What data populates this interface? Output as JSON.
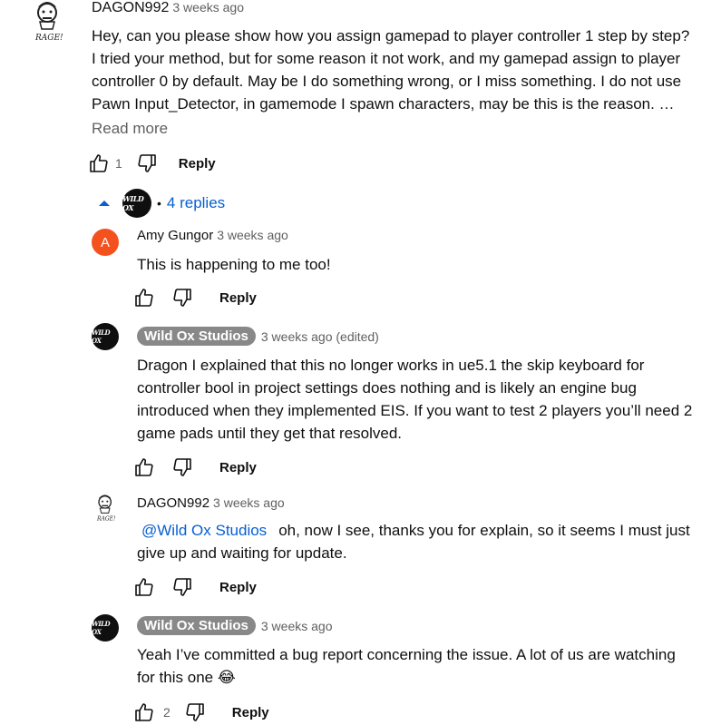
{
  "comment": {
    "author": "DAGON992",
    "time": "3 weeks ago",
    "lines": [
      "Hey, can you please show how you assign gamepad to player controller 1 step by step?",
      "I tried your method, but for some reason it not work, and my gamepad assign to player",
      "controller 0 by default. May be I do something wrong, or I miss something. I do not use",
      "Pawn Input_Detector, in gamemode I spawn characters, may be this is the reason. …"
    ],
    "read_more": "Read more",
    "likes": "1",
    "reply_label": "Reply",
    "avatar_caption": "RAGE!"
  },
  "replies_toggle": {
    "label": "4 replies",
    "separator": "•",
    "avatar_text": "WILD OX"
  },
  "replies": [
    {
      "author": "Amy Gungor",
      "time": "3 weeks ago",
      "avatar_letter": "A",
      "avatar_color": "#f4511e",
      "lines": [
        "This is happening to me too!"
      ],
      "reply_label": "Reply"
    },
    {
      "author": "Wild Ox Studios",
      "time": "3 weeks ago (edited)",
      "avatar_text": "WILD OX",
      "lines": [
        "Dragon I explained that this no longer works in ue5.1 the skip keyboard for",
        "controller bool in project settings does nothing and is likely an engine bug",
        "introduced when they implemented EIS. If you want to test 2 players you’ll need 2",
        "game pads until they get that resolved."
      ],
      "reply_label": "Reply"
    },
    {
      "author": "DAGON992",
      "time": "3 weeks ago",
      "mention": "@Wild Ox Studios",
      "line1_rest": "oh, now I see, thanks you for explain, so it seems I must just",
      "line2": "give up and waiting for update.",
      "avatar_caption": "RAGE!",
      "reply_label": "Reply"
    },
    {
      "author": "Wild Ox Studios",
      "time": "3 weeks ago",
      "avatar_text": "WILD OX",
      "lines": [
        "Yeah I’ve committed a bug report concerning the issue. A lot of us are watching",
        "for this one 😂"
      ],
      "likes": "2",
      "reply_label": "Reply"
    }
  ],
  "colors": {
    "link_blue": "#065fd4",
    "badge_gray": "#888888",
    "secondary_text": "#606060"
  },
  "icons": [
    "thumbs-up-icon",
    "thumbs-down-icon",
    "collapse-arrow-icon",
    "rage-face-avatar"
  ]
}
